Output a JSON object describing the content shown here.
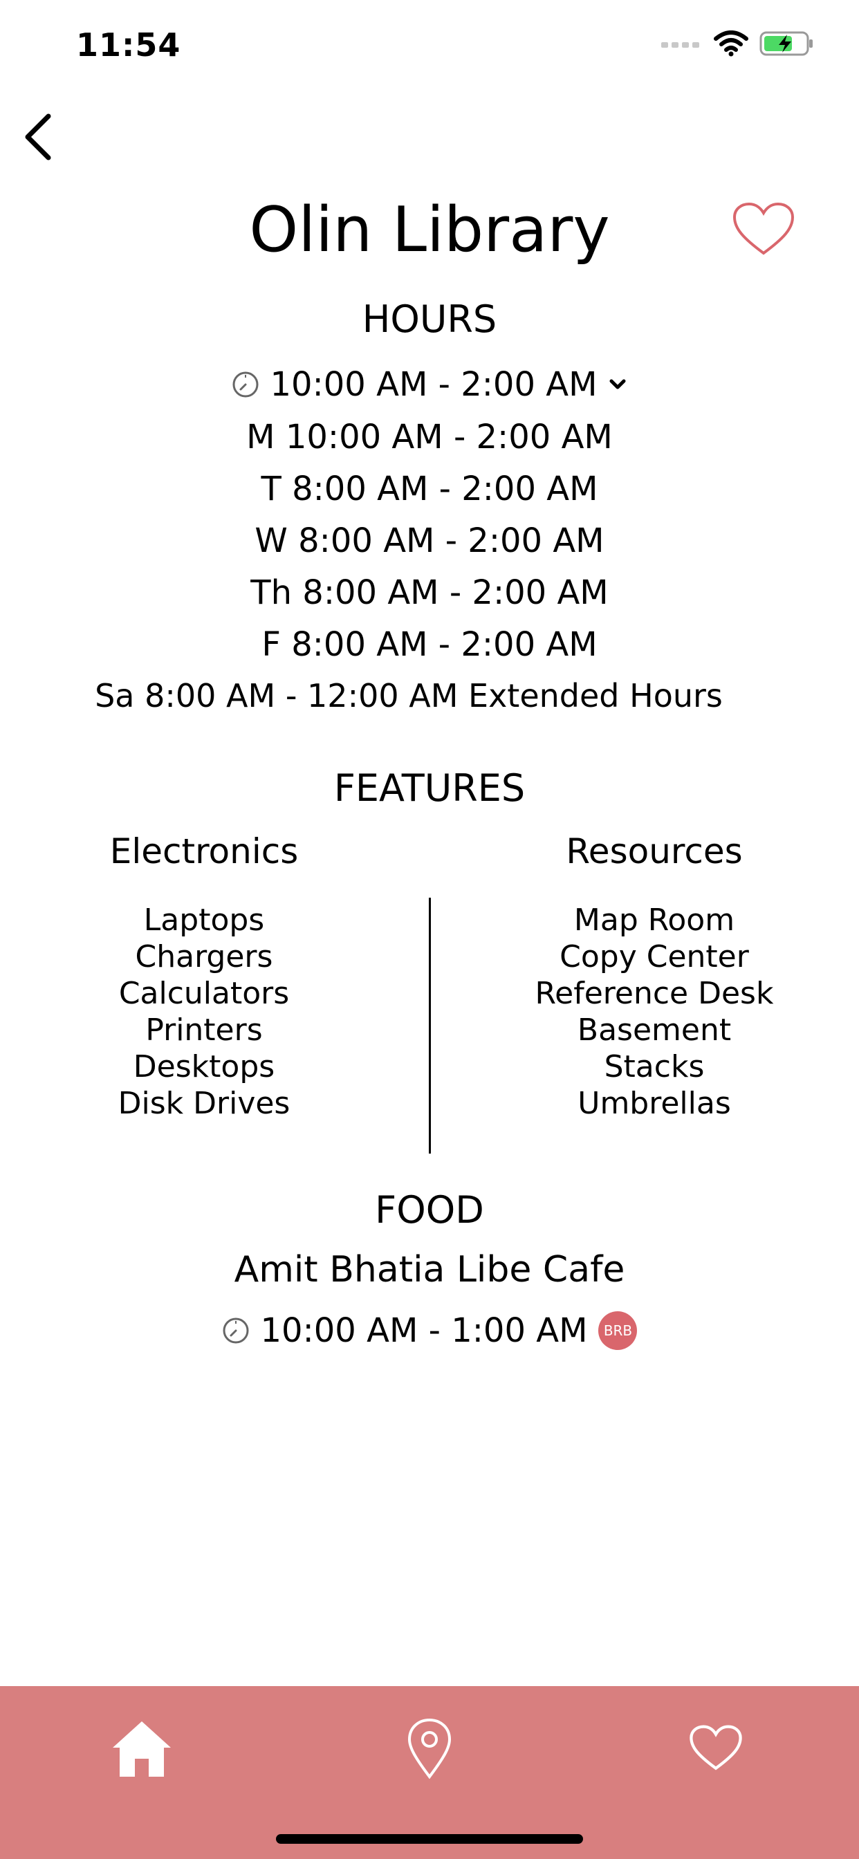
{
  "status_bar": {
    "time": "11:54"
  },
  "header": {
    "title": "Olin Library"
  },
  "hours": {
    "heading": "HOURS",
    "current": "10:00 AM - 2:00 AM",
    "rows": [
      "M 10:00 AM - 2:00 AM",
      "T 8:00 AM - 2:00 AM",
      "W 8:00 AM - 2:00 AM",
      "Th 8:00 AM - 2:00 AM",
      "F 8:00 AM - 2:00 AM",
      "Sa 8:00 AM - 12:00 AM Extended Hours"
    ]
  },
  "features": {
    "heading": "FEATURES",
    "electronics": {
      "title": "Electronics",
      "items": [
        "Laptops",
        "Chargers",
        "Calculators",
        "Printers",
        "Desktops",
        "Disk Drives"
      ]
    },
    "resources": {
      "title": "Resources",
      "items": [
        "Map Room",
        "Copy Center",
        "Reference Desk",
        "Basement",
        "Stacks",
        "Umbrellas"
      ]
    }
  },
  "food": {
    "heading": "FOOD",
    "cafe_name": "Amit Bhatia Libe Cafe",
    "cafe_hours": "10:00 AM - 1:00 AM",
    "badge": "BRB"
  },
  "colors": {
    "accent": "#d87f7f",
    "heart": "#d9666c",
    "badge": "#d9666c"
  },
  "icons": [
    "back-arrow-icon",
    "heart-outline-icon",
    "clock-icon",
    "chevron-down-icon",
    "home-icon",
    "map-pin-icon",
    "heart-icon"
  ]
}
